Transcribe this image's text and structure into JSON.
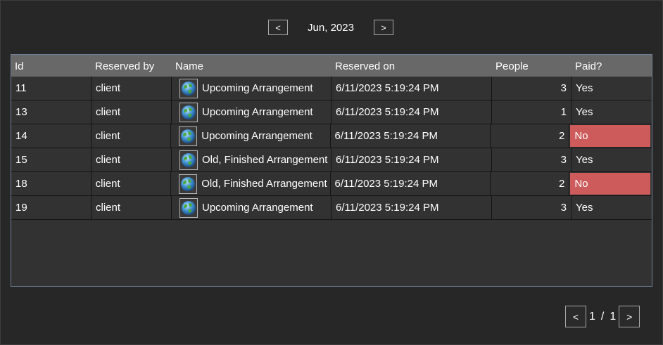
{
  "month_nav": {
    "prev_label": "<",
    "next_label": ">",
    "current": "Jun, 2023"
  },
  "table": {
    "columns": [
      "Id",
      "Reserved by",
      "Name",
      "Reserved on",
      "People",
      "Paid?"
    ],
    "rows": [
      {
        "id": "11",
        "reserved_by": "client",
        "name": "Upcoming Arrangement",
        "reserved_on": "6/11/2023 5:19:24 PM",
        "people": "3",
        "paid": "Yes"
      },
      {
        "id": "13",
        "reserved_by": "client",
        "name": "Upcoming Arrangement",
        "reserved_on": "6/11/2023 5:19:24 PM",
        "people": "1",
        "paid": "Yes"
      },
      {
        "id": "14",
        "reserved_by": "client",
        "name": "Upcoming Arrangement",
        "reserved_on": "6/11/2023 5:19:24 PM",
        "people": "2",
        "paid": "No"
      },
      {
        "id": "15",
        "reserved_by": "client",
        "name": "Old, Finished Arrangement",
        "reserved_on": "6/11/2023 5:19:24 PM",
        "people": "3",
        "paid": "Yes"
      },
      {
        "id": "18",
        "reserved_by": "client",
        "name": "Old, Finished Arrangement",
        "reserved_on": "6/11/2023 5:19:24 PM",
        "people": "2",
        "paid": "No"
      },
      {
        "id": "19",
        "reserved_by": "client",
        "name": "Upcoming Arrangement",
        "reserved_on": "6/11/2023 5:19:24 PM",
        "people": "3",
        "paid": "Yes"
      }
    ],
    "row_icon": "globe-icon",
    "unpaid_color": "#cd5b5b"
  },
  "pager": {
    "prev_label": "<",
    "next_label": ">",
    "current_page": "1",
    "separator": "/",
    "total_pages": "1"
  }
}
